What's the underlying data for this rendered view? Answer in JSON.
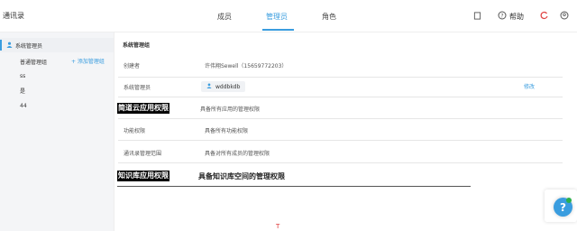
{
  "app": {
    "title": "通讯录"
  },
  "tabs": [
    {
      "label": "成员",
      "active": false
    },
    {
      "label": "管理员",
      "active": true
    },
    {
      "label": "角色",
      "active": false
    }
  ],
  "toolbar": {
    "help_label": "帮助",
    "icons": [
      "book-icon",
      "help-icon",
      "notification-icon",
      "user-settings-icon"
    ]
  },
  "sidebar": {
    "items": [
      {
        "label": "系统管理员",
        "active": true
      },
      {
        "label": "普通管理组",
        "active": false
      },
      {
        "label": "ss",
        "active": false
      },
      {
        "label": "是",
        "active": false
      },
      {
        "label": "44",
        "active": false
      }
    ],
    "add_label": "+ 添加管理组"
  },
  "main": {
    "section_title": "系统管理组",
    "creator_key": "创建者",
    "creator_value": "许伟翔Sewell（15659772203）",
    "admin_key": "系统管理员",
    "admin_chip": "wddbkdb",
    "edit_label": "修改",
    "app_perm_key": "简道云应用权限",
    "app_perm_value": "具备所有应用的管理权限",
    "func_perm_key": "功能权限",
    "func_perm_value": "具备所有功能权限",
    "contacts_scope_key": "通讯录管理范围",
    "contacts_scope_value": "具备对所有成员的管理权限",
    "kb_perm_key": "知识库应用权限",
    "kb_perm_value": "具备知识库空间的管理权限"
  },
  "colors": {
    "accent": "#3a9ddf",
    "sidebar_bg": "#f4f5f7"
  }
}
